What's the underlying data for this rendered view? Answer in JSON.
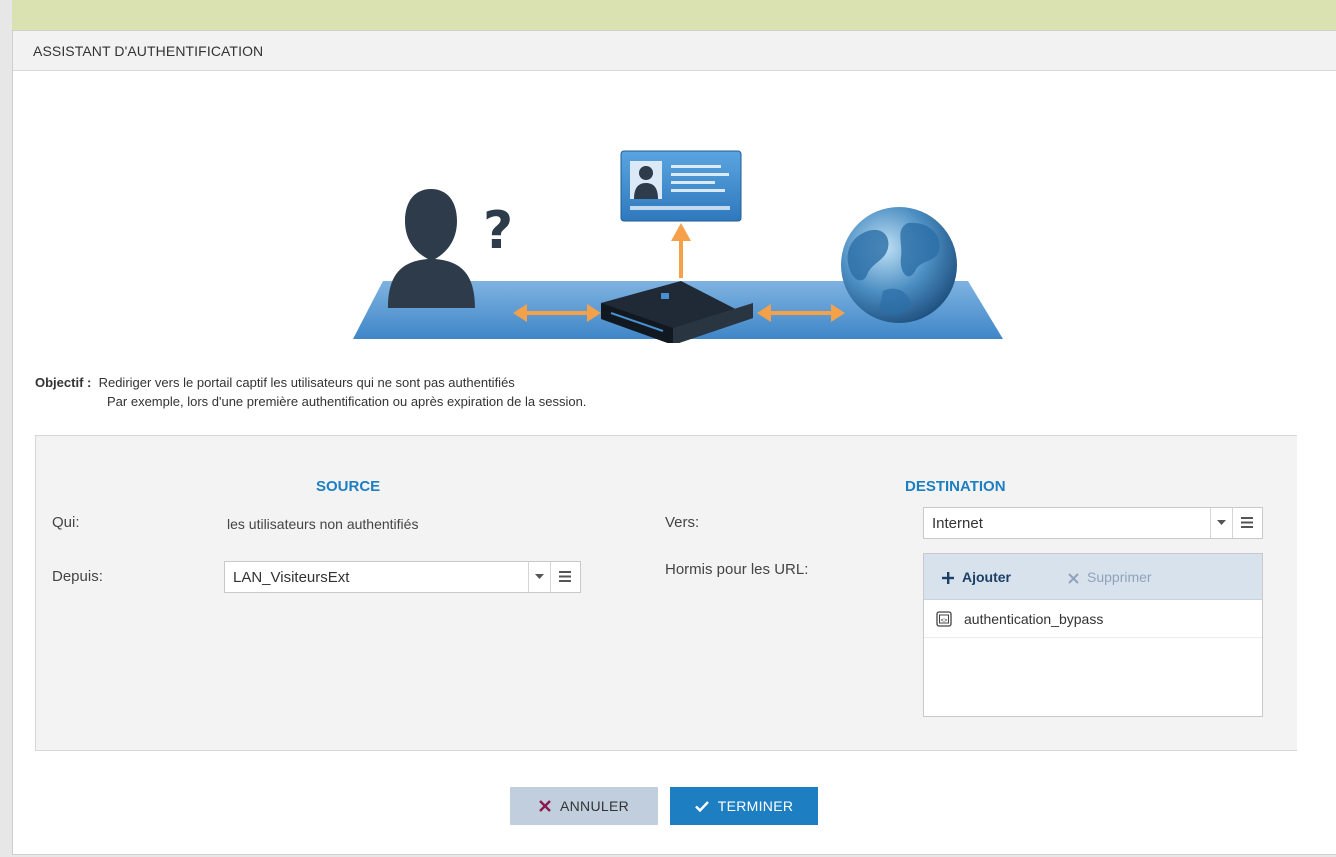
{
  "dialog": {
    "title": "ASSISTANT D'AUTHENTIFICATION"
  },
  "objective": {
    "label": "Objectif :",
    "line1": "Rediriger vers le portail captif les utilisateurs qui ne sont pas authentifiés",
    "line2": "Par exemple, lors d'une première authentification ou après expiration de la session."
  },
  "source": {
    "heading": "SOURCE",
    "qui_label": "Qui:",
    "qui_value": "les utilisateurs non authentifiés",
    "depuis_label": "Depuis:",
    "depuis_value": "LAN_VisiteursExt"
  },
  "destination": {
    "heading": "DESTINATION",
    "vers_label": "Vers:",
    "vers_value": "Internet",
    "hormis_label": "Hormis pour les URL:",
    "toolbar": {
      "add_label": "Ajouter",
      "remove_label": "Supprimer"
    },
    "urls": [
      "authentication_bypass"
    ]
  },
  "buttons": {
    "cancel_label": "ANNULER",
    "finish_label": "TERMINER"
  },
  "colors": {
    "accent": "#1d7fc2",
    "cancel_bg": "#c0cedd",
    "toolbar_bg": "#d8e2ec",
    "remove_icon": "#8b1a4a"
  }
}
